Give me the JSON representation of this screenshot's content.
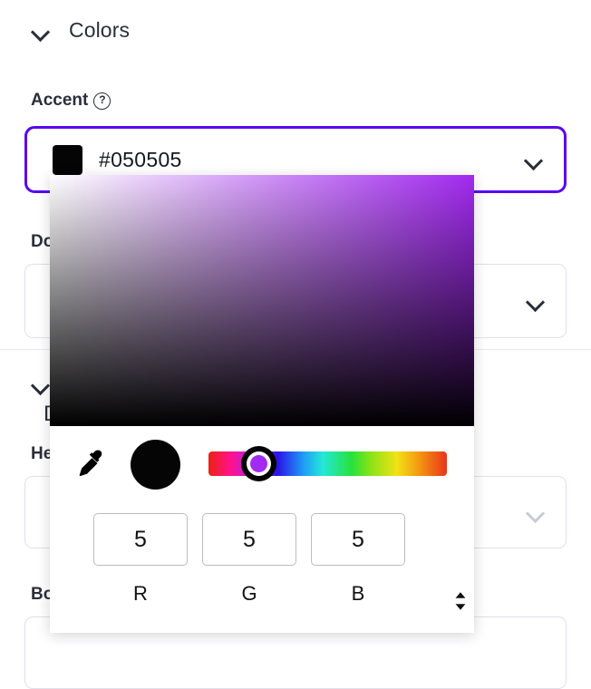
{
  "section": {
    "title": "Colors",
    "toggle_icon": "chevron-down-icon"
  },
  "accent_field": {
    "label": "Accent",
    "help_icon": "help-circle-icon",
    "swatch_color": "#050505",
    "hex_value": "#050505",
    "dropdown_icon": "chevron-down-icon",
    "focus_border_color": "#5a06ef"
  },
  "obscured_fields": [
    {
      "label": "Do",
      "dropdown_icon": "chevron-down-icon"
    },
    {
      "label": "He",
      "dropdown_icon": "chevron-down-icon"
    },
    {
      "label": "Bo",
      "dropdown_icon": "chevron-down-icon"
    }
  ],
  "second_section": {
    "toggle_icon": "chevron-down-icon",
    "partial_label": "D"
  },
  "picker": {
    "saturation_area": {
      "name": "saturation-value-area",
      "hue_color": "#a22af0"
    },
    "eyedropper_icon": "eyedropper-icon",
    "preview_color": "#050505",
    "hue_slider": {
      "name": "hue-slider",
      "handle_color": "#a32af0",
      "handle_position_percent": 17
    },
    "channels": [
      {
        "label": "R",
        "value": "5"
      },
      {
        "label": "G",
        "value": "5"
      },
      {
        "label": "B",
        "value": "5"
      }
    ],
    "stepper_icon": "chevron-up-down-icon"
  }
}
